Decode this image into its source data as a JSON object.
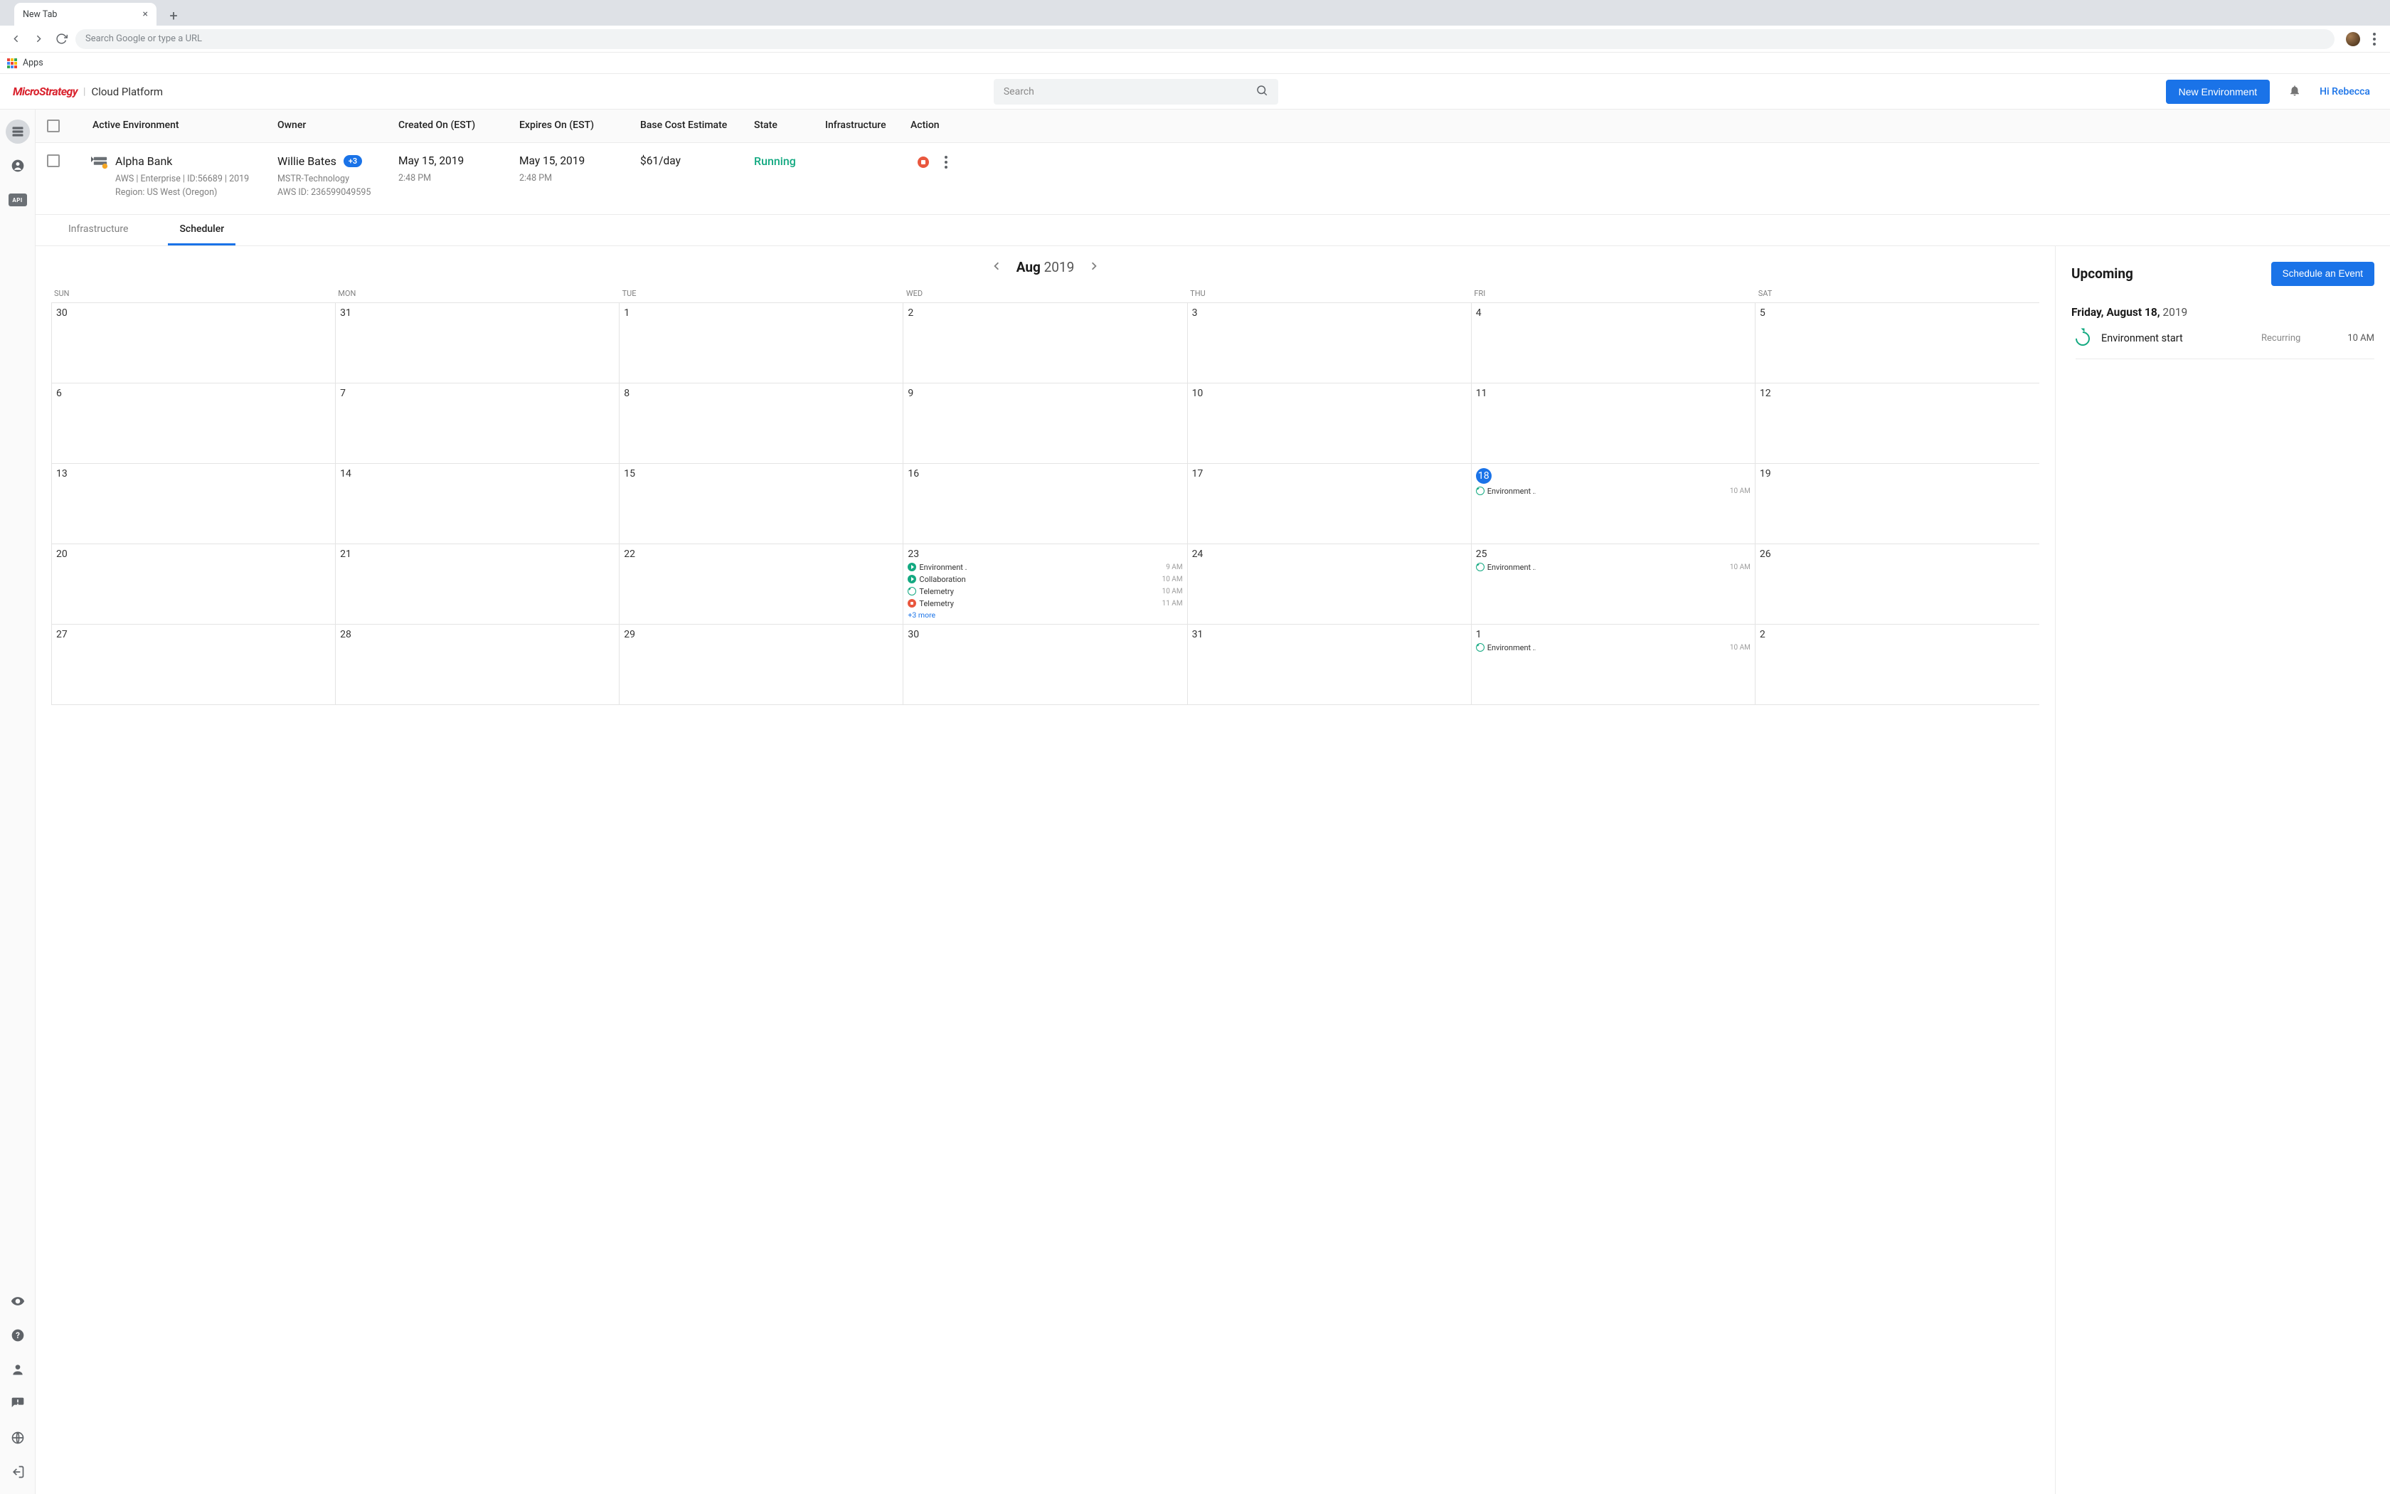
{
  "browser": {
    "tab_title": "New Tab",
    "omnibox_placeholder": "Search Google or type a URL",
    "bookmarks": {
      "apps": "Apps"
    }
  },
  "header": {
    "brand": "MicroStrategy",
    "product": "Cloud Platform",
    "search_placeholder": "Search",
    "new_env_btn": "New Environment",
    "greeting": "Hi Rebecca"
  },
  "table": {
    "columns": {
      "active_env": "Active Environment",
      "owner": "Owner",
      "created": "Created On (EST)",
      "expires": "Expires On (EST)",
      "cost": "Base Cost Estimate",
      "state": "State",
      "infrastructure": "Infrastructure",
      "action": "Action"
    },
    "row": {
      "name": "Alpha Bank",
      "meta1": "AWS | Enterprise | ID:56689 | 2019",
      "meta2": "Region: US West (Oregon)",
      "owner": "Willie Bates",
      "owner_badge": "+3",
      "owner_meta1": "MSTR-Technology",
      "owner_meta2": "AWS ID: 236599049595",
      "created": "May 15, 2019",
      "created_time": "2:48 PM",
      "expires": "May 15, 2019",
      "expires_time": "2:48 PM",
      "cost": "$61/day",
      "state": "Running"
    }
  },
  "tabs": {
    "infrastructure": "Infrastructure",
    "scheduler": "Scheduler"
  },
  "calendar": {
    "month": "Aug",
    "year": "2019",
    "dow": [
      "SUN",
      "MON",
      "TUE",
      "WED",
      "THU",
      "FRI",
      "SAT"
    ],
    "cells": [
      {
        "d": "30"
      },
      {
        "d": "31"
      },
      {
        "d": "1"
      },
      {
        "d": "2"
      },
      {
        "d": "3"
      },
      {
        "d": "4"
      },
      {
        "d": "5"
      },
      {
        "d": "6"
      },
      {
        "d": "7"
      },
      {
        "d": "8"
      },
      {
        "d": "9"
      },
      {
        "d": "10"
      },
      {
        "d": "11"
      },
      {
        "d": "12"
      },
      {
        "d": "13"
      },
      {
        "d": "14"
      },
      {
        "d": "15"
      },
      {
        "d": "16"
      },
      {
        "d": "17"
      },
      {
        "d": "18",
        "today": true,
        "events": [
          {
            "icon": "recur",
            "name": "Environment ..",
            "time": "10 AM"
          }
        ]
      },
      {
        "d": "19"
      },
      {
        "d": "20"
      },
      {
        "d": "21"
      },
      {
        "d": "22"
      },
      {
        "d": "23",
        "events": [
          {
            "icon": "play",
            "name": "Environment ..",
            "time": "9 AM"
          },
          {
            "icon": "play",
            "name": "Collaboration .",
            "time": "10 AM"
          },
          {
            "icon": "recur",
            "name": "Telemetry",
            "time": "10 AM"
          },
          {
            "icon": "stop",
            "name": "Telemetry",
            "time": "11 AM"
          }
        ],
        "more": "+3 more"
      },
      {
        "d": "24"
      },
      {
        "d": "25",
        "events": [
          {
            "icon": "recur",
            "name": "Environment ..",
            "time": "10 AM"
          }
        ]
      },
      {
        "d": "26"
      },
      {
        "d": "27"
      },
      {
        "d": "28"
      },
      {
        "d": "29"
      },
      {
        "d": "30"
      },
      {
        "d": "31"
      },
      {
        "d": "1",
        "events": [
          {
            "icon": "recur",
            "name": "Environment ..",
            "time": "10 AM"
          }
        ]
      },
      {
        "d": "2"
      }
    ]
  },
  "upcoming": {
    "title": "Upcoming",
    "schedule_btn": "Schedule an Event",
    "selected_day": "Friday, August 18,",
    "selected_year": "2019",
    "event": {
      "name": "Environment start",
      "recurring": "Recurring",
      "time": "10 AM"
    }
  }
}
